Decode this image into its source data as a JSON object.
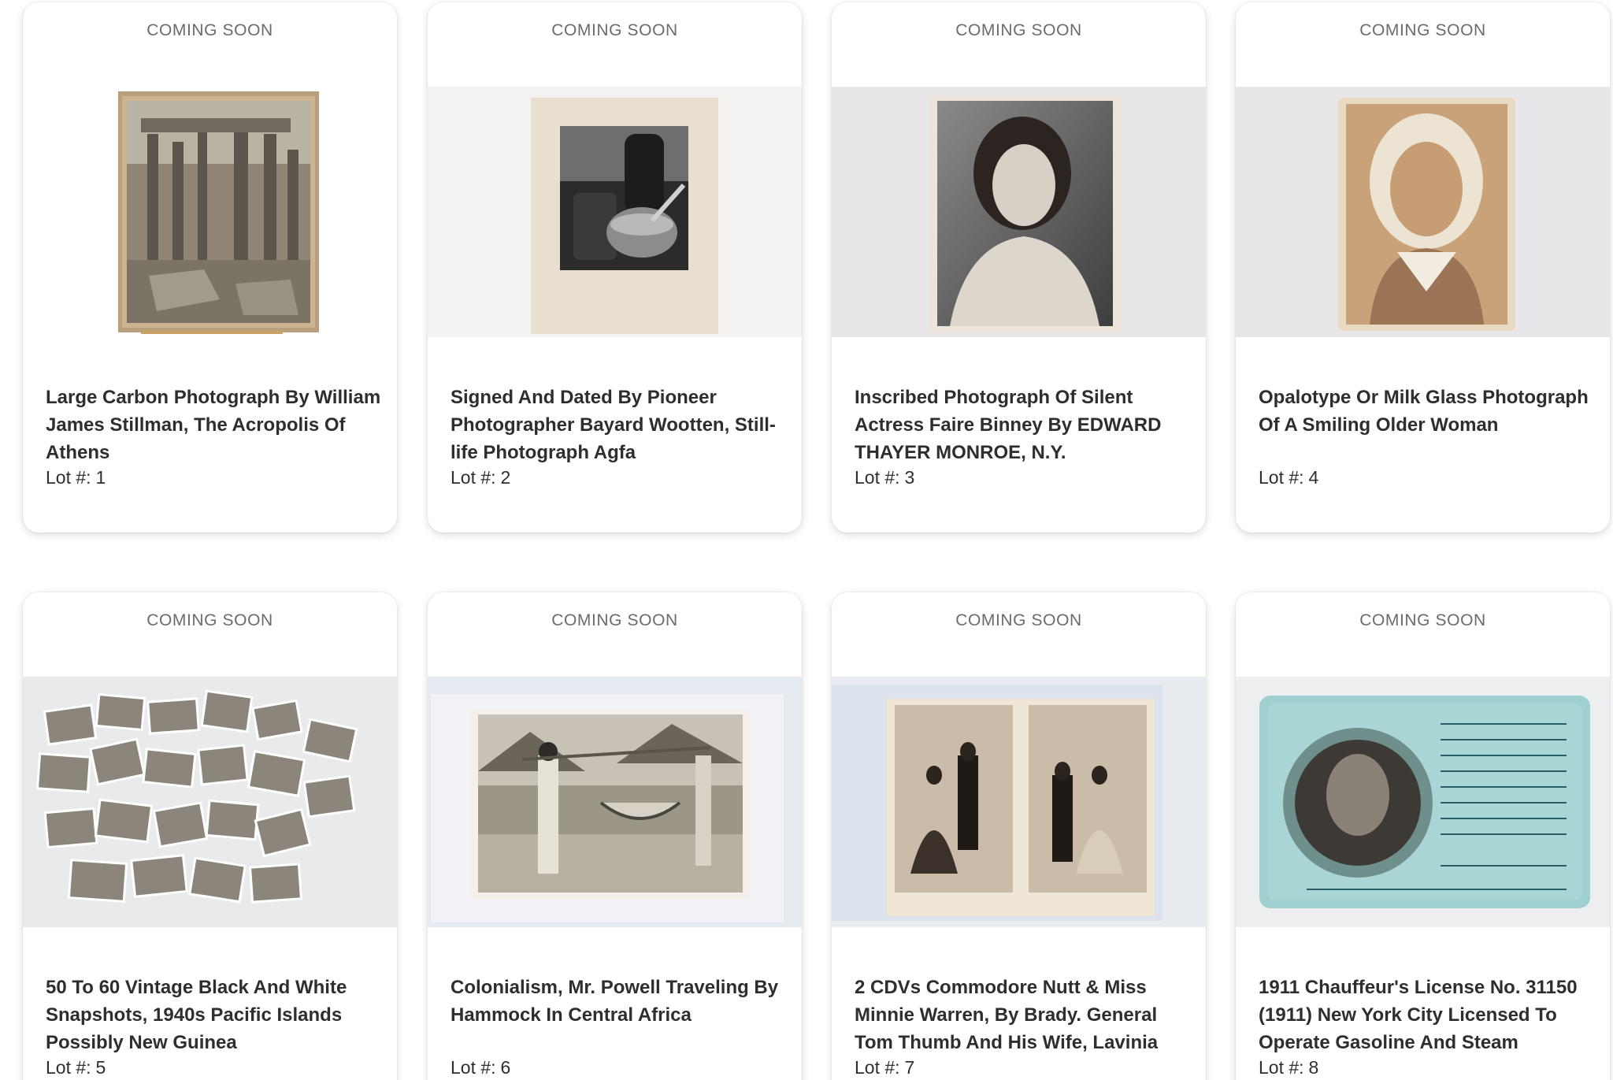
{
  "lots": [
    {
      "badge": "COMING SOON",
      "title": "Large Carbon Photograph By William James Stillman, The Acropolis Of Athens",
      "lot_label": "Lot #:",
      "lot_number": "1"
    },
    {
      "badge": "COMING SOON",
      "title": "Signed And Dated By Pioneer Photographer Bayard Wootten, Still-life Photograph Agfa",
      "lot_label": "Lot #:",
      "lot_number": "2"
    },
    {
      "badge": "COMING SOON",
      "title": "Inscribed Photograph Of Silent Actress Faire Binney By EDWARD THAYER MONROE, N.Y.",
      "lot_label": "Lot #:",
      "lot_number": "3"
    },
    {
      "badge": "COMING SOON",
      "title": "Opalotype Or Milk Glass Photograph Of A Smiling Older Woman",
      "lot_label": "Lot #:",
      "lot_number": "4"
    },
    {
      "badge": "COMING SOON",
      "title": "50 To 60 Vintage Black And White Snapshots, 1940s Pacific Islands Possibly New Guinea",
      "lot_label": "Lot #:",
      "lot_number": "5"
    },
    {
      "badge": "COMING SOON",
      "title": "Colonialism, Mr. Powell Traveling By Hammock In Central Africa",
      "lot_label": "Lot #:",
      "lot_number": "6"
    },
    {
      "badge": "COMING SOON",
      "title": "2 CDVs Commodore Nutt & Miss Minnie Warren, By Brady. General Tom Thumb And His Wife, Lavinia",
      "lot_label": "Lot #:",
      "lot_number": "7"
    },
    {
      "badge": "COMING SOON",
      "title": "1911 Chauffeur's License No. 31150 (1911) New York City Licensed To Operate Gasoline And Steam",
      "lot_label": "Lot #:",
      "lot_number": "8"
    }
  ]
}
